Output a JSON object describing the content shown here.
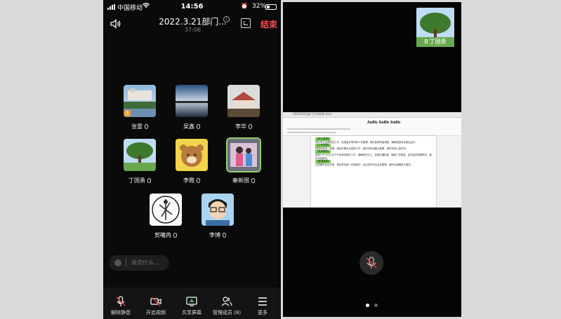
{
  "status_bar": {
    "carrier": "中国移动",
    "time": "14:56",
    "battery": "32%"
  },
  "header": {
    "title": "2022.3.21部门...",
    "elapsed": "37:06",
    "end_label": "结束"
  },
  "participants": [
    {
      "name": "张雷",
      "badge": "主"
    },
    {
      "name": "吴鑫"
    },
    {
      "name": "李华"
    },
    {
      "name": "丁国勇"
    },
    {
      "name": "李霞"
    },
    {
      "name": "秦新国",
      "active": true
    },
    {
      "name": "贺曦冉"
    },
    {
      "name": "李博"
    }
  ],
  "chat": {
    "placeholder": "说点什么..."
  },
  "toolbar": {
    "unmute": "解除静音",
    "video": "开启视频",
    "share": "共享屏幕",
    "members": "管理成员 (8)",
    "more": "更多"
  },
  "right": {
    "thumb_name": "丁国勇",
    "doc": {
      "filename": "2022年3月部门工作安排.docx",
      "ribbon_sample": "AaBb AaBb AaBb",
      "sections": [
        {
          "heading": "【关注事项】",
          "text": "抓好学生疫情防控工作，加强重点场所和人员管理，落实各项防疫措施，确保校园安全稳定运行。"
        },
        {
          "heading": "【工作安排】",
          "text": "按照学校统一部署，组织开展本月各项工作，做好材料收集与整理，按时完成上报任务。"
        },
        {
          "heading": "【具体要求】",
          "text": "各部门于3月21日下午前完成相关工作，明确责任分工，加强沟通协调，确保工作质量，及时反馈进展情况，做好总结报告。"
        },
        {
          "heading": "【其他事项】",
          "text": "注意做好会议记录，相关资料统一归档保存，会后及时传达会议精神，做好后续跟进与落实。"
        }
      ]
    }
  },
  "colors": {
    "end": "#ff4d4f",
    "active_border": "#8fd16d",
    "highlight": "#7cd65a",
    "muted_red": "#e53935"
  }
}
